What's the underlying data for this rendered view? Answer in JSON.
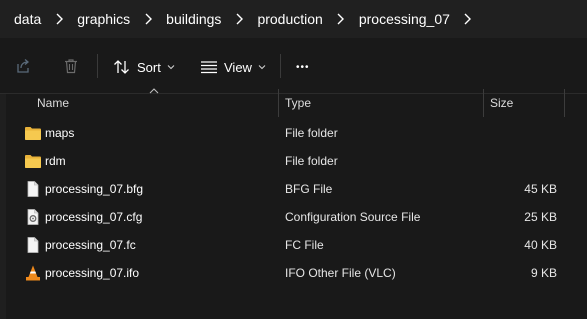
{
  "breadcrumb": {
    "items": [
      "data",
      "graphics",
      "buildings",
      "production",
      "processing_07"
    ]
  },
  "toolbar": {
    "sort_label": "Sort",
    "view_label": "View",
    "more_label": "•••"
  },
  "columns": {
    "name": "Name",
    "type": "Type",
    "size": "Size"
  },
  "files": [
    {
      "name": "maps",
      "type": "File folder",
      "size": "",
      "icon": "folder-icon"
    },
    {
      "name": "rdm",
      "type": "File folder",
      "size": "",
      "icon": "folder-icon"
    },
    {
      "name": "processing_07.bfg",
      "type": "BFG File",
      "size": "45 KB",
      "icon": "file-icon"
    },
    {
      "name": "processing_07.cfg",
      "type": "Configuration Source File",
      "size": "25 KB",
      "icon": "config-file-icon"
    },
    {
      "name": "processing_07.fc",
      "type": "FC File",
      "size": "40 KB",
      "icon": "file-icon"
    },
    {
      "name": "processing_07.ifo",
      "type": "IFO Other File (VLC)",
      "size": "9 KB",
      "icon": "vlc-icon"
    }
  ],
  "colors": {
    "background": "#191919",
    "folder": "#f2c24a",
    "vlc_orange": "#f08a1c"
  }
}
